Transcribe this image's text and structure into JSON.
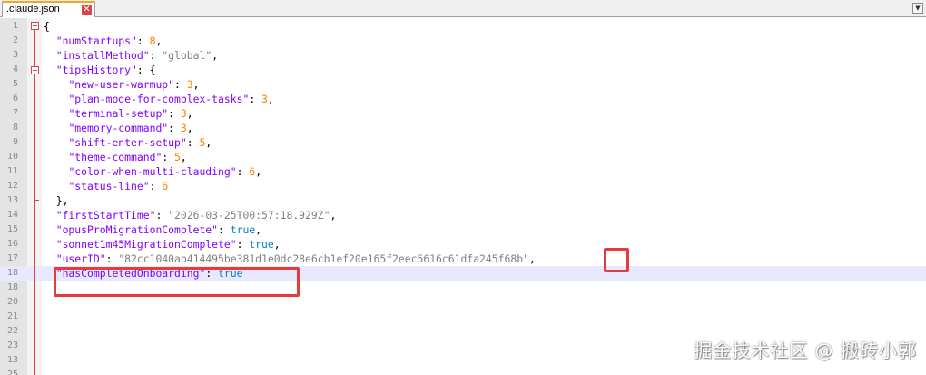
{
  "tab": {
    "filename": ".claude.json",
    "close_glyph": "✕"
  },
  "colors": {
    "key": "#8000ff",
    "string": "#808080",
    "number": "#ff8000",
    "boolean": "#0080c0",
    "highlight": "#e53b3b"
  },
  "lines": [
    {
      "num": "1",
      "tokens": [
        [
          "p",
          "{"
        ]
      ]
    },
    {
      "num": "2",
      "tokens": [
        [
          "p",
          "  "
        ],
        [
          "k",
          "\"numStartups\""
        ],
        [
          "p",
          ": "
        ],
        [
          "n",
          "8"
        ],
        [
          "p",
          ","
        ]
      ]
    },
    {
      "num": "3",
      "tokens": [
        [
          "p",
          "  "
        ],
        [
          "k",
          "\"installMethod\""
        ],
        [
          "p",
          ": "
        ],
        [
          "s",
          "\"global\""
        ],
        [
          "p",
          ","
        ]
      ]
    },
    {
      "num": "4",
      "tokens": [
        [
          "p",
          "  "
        ],
        [
          "k",
          "\"tipsHistory\""
        ],
        [
          "p",
          ": {"
        ]
      ]
    },
    {
      "num": "5",
      "tokens": [
        [
          "p",
          "    "
        ],
        [
          "k",
          "\"new-user-warmup\""
        ],
        [
          "p",
          ": "
        ],
        [
          "n",
          "3"
        ],
        [
          "p",
          ","
        ]
      ]
    },
    {
      "num": "6",
      "tokens": [
        [
          "p",
          "    "
        ],
        [
          "k",
          "\"plan-mode-for-complex-tasks\""
        ],
        [
          "p",
          ": "
        ],
        [
          "n",
          "3"
        ],
        [
          "p",
          ","
        ]
      ]
    },
    {
      "num": "7",
      "tokens": [
        [
          "p",
          "    "
        ],
        [
          "k",
          "\"terminal-setup\""
        ],
        [
          "p",
          ": "
        ],
        [
          "n",
          "3"
        ],
        [
          "p",
          ","
        ]
      ]
    },
    {
      "num": "8",
      "tokens": [
        [
          "p",
          "    "
        ],
        [
          "k",
          "\"memory-command\""
        ],
        [
          "p",
          ": "
        ],
        [
          "n",
          "3"
        ],
        [
          "p",
          ","
        ]
      ]
    },
    {
      "num": "9",
      "tokens": [
        [
          "p",
          "    "
        ],
        [
          "k",
          "\"shift-enter-setup\""
        ],
        [
          "p",
          ": "
        ],
        [
          "n",
          "5"
        ],
        [
          "p",
          ","
        ]
      ]
    },
    {
      "num": "10",
      "tokens": [
        [
          "p",
          "    "
        ],
        [
          "k",
          "\"theme-command\""
        ],
        [
          "p",
          ": "
        ],
        [
          "n",
          "5"
        ],
        [
          "p",
          ","
        ]
      ]
    },
    {
      "num": "11",
      "tokens": [
        [
          "p",
          "    "
        ],
        [
          "k",
          "\"color-when-multi-clauding\""
        ],
        [
          "p",
          ": "
        ],
        [
          "n",
          "6"
        ],
        [
          "p",
          ","
        ]
      ]
    },
    {
      "num": "12",
      "tokens": [
        [
          "p",
          "    "
        ],
        [
          "k",
          "\"status-line\""
        ],
        [
          "p",
          ": "
        ],
        [
          "n",
          "6"
        ]
      ]
    },
    {
      "num": "13",
      "tokens": [
        [
          "p",
          "  },"
        ]
      ]
    },
    {
      "num": "14",
      "tokens": [
        [
          "p",
          "  "
        ],
        [
          "k",
          "\"firstStartTime\""
        ],
        [
          "p",
          ": "
        ],
        [
          "s",
          "\"2026-03-25T00:57:18.929Z\""
        ],
        [
          "p",
          ","
        ]
      ]
    },
    {
      "num": "15",
      "tokens": [
        [
          "p",
          "  "
        ],
        [
          "k",
          "\"opusProMigrationComplete\""
        ],
        [
          "p",
          ": "
        ],
        [
          "b",
          "true"
        ],
        [
          "p",
          ","
        ]
      ]
    },
    {
      "num": "16",
      "tokens": [
        [
          "p",
          "  "
        ],
        [
          "k",
          "\"sonnet1m45MigrationComplete\""
        ],
        [
          "p",
          ": "
        ],
        [
          "b",
          "true"
        ],
        [
          "p",
          ","
        ]
      ]
    },
    {
      "num": "17",
      "tokens": [
        [
          "p",
          "  "
        ],
        [
          "k",
          "\"userID\""
        ],
        [
          "p",
          ": "
        ],
        [
          "s",
          "\"82cc1040ab414495be381d1e0dc28e6cb1ef20e165f2eec5616c61dfa245f68b\""
        ],
        [
          "p",
          ","
        ]
      ]
    },
    {
      "num": "18",
      "tokens": [
        [
          "p",
          "  "
        ],
        [
          "k",
          "\"hasCompletedOnboarding\""
        ],
        [
          "p",
          ": "
        ],
        [
          "b",
          "true"
        ]
      ]
    },
    {
      "num": "18",
      "tokens": []
    },
    {
      "num": "20",
      "tokens": []
    },
    {
      "num": "21",
      "tokens": []
    },
    {
      "num": "22",
      "tokens": []
    },
    {
      "num": "23",
      "tokens": []
    },
    {
      "num": "13",
      "tokens": []
    },
    {
      "num": "25",
      "tokens": []
    }
  ],
  "watermark": "掘金技术社区 @ 搬砖小郭"
}
